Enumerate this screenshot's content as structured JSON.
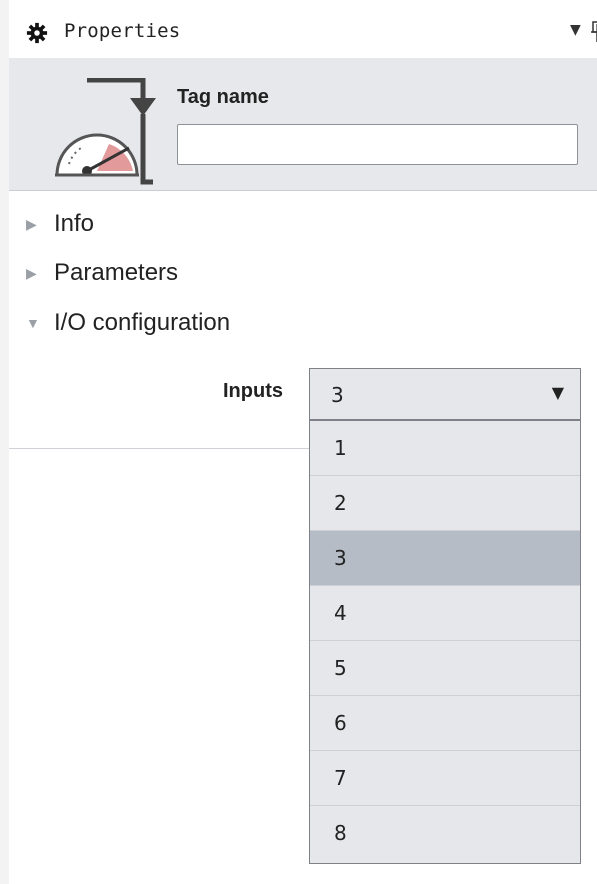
{
  "panel": {
    "title": "Properties",
    "title_icon": "gear-icon"
  },
  "header": {
    "icon": "gauge-icon",
    "tag_label": "Tag name",
    "tag_value": ""
  },
  "sections": [
    {
      "label": "Info",
      "expanded": false
    },
    {
      "label": "Parameters",
      "expanded": false
    },
    {
      "label": "I/O configuration",
      "expanded": true
    }
  ],
  "io": {
    "inputs_label": "Inputs",
    "selected": "3",
    "options": [
      "1",
      "2",
      "3",
      "4",
      "5",
      "6",
      "7",
      "8"
    ]
  },
  "colors": {
    "header_bg": "#e6e8eb",
    "dropdown_bg": "#e5e7ea",
    "selected_bg": "#b6bcc5"
  }
}
